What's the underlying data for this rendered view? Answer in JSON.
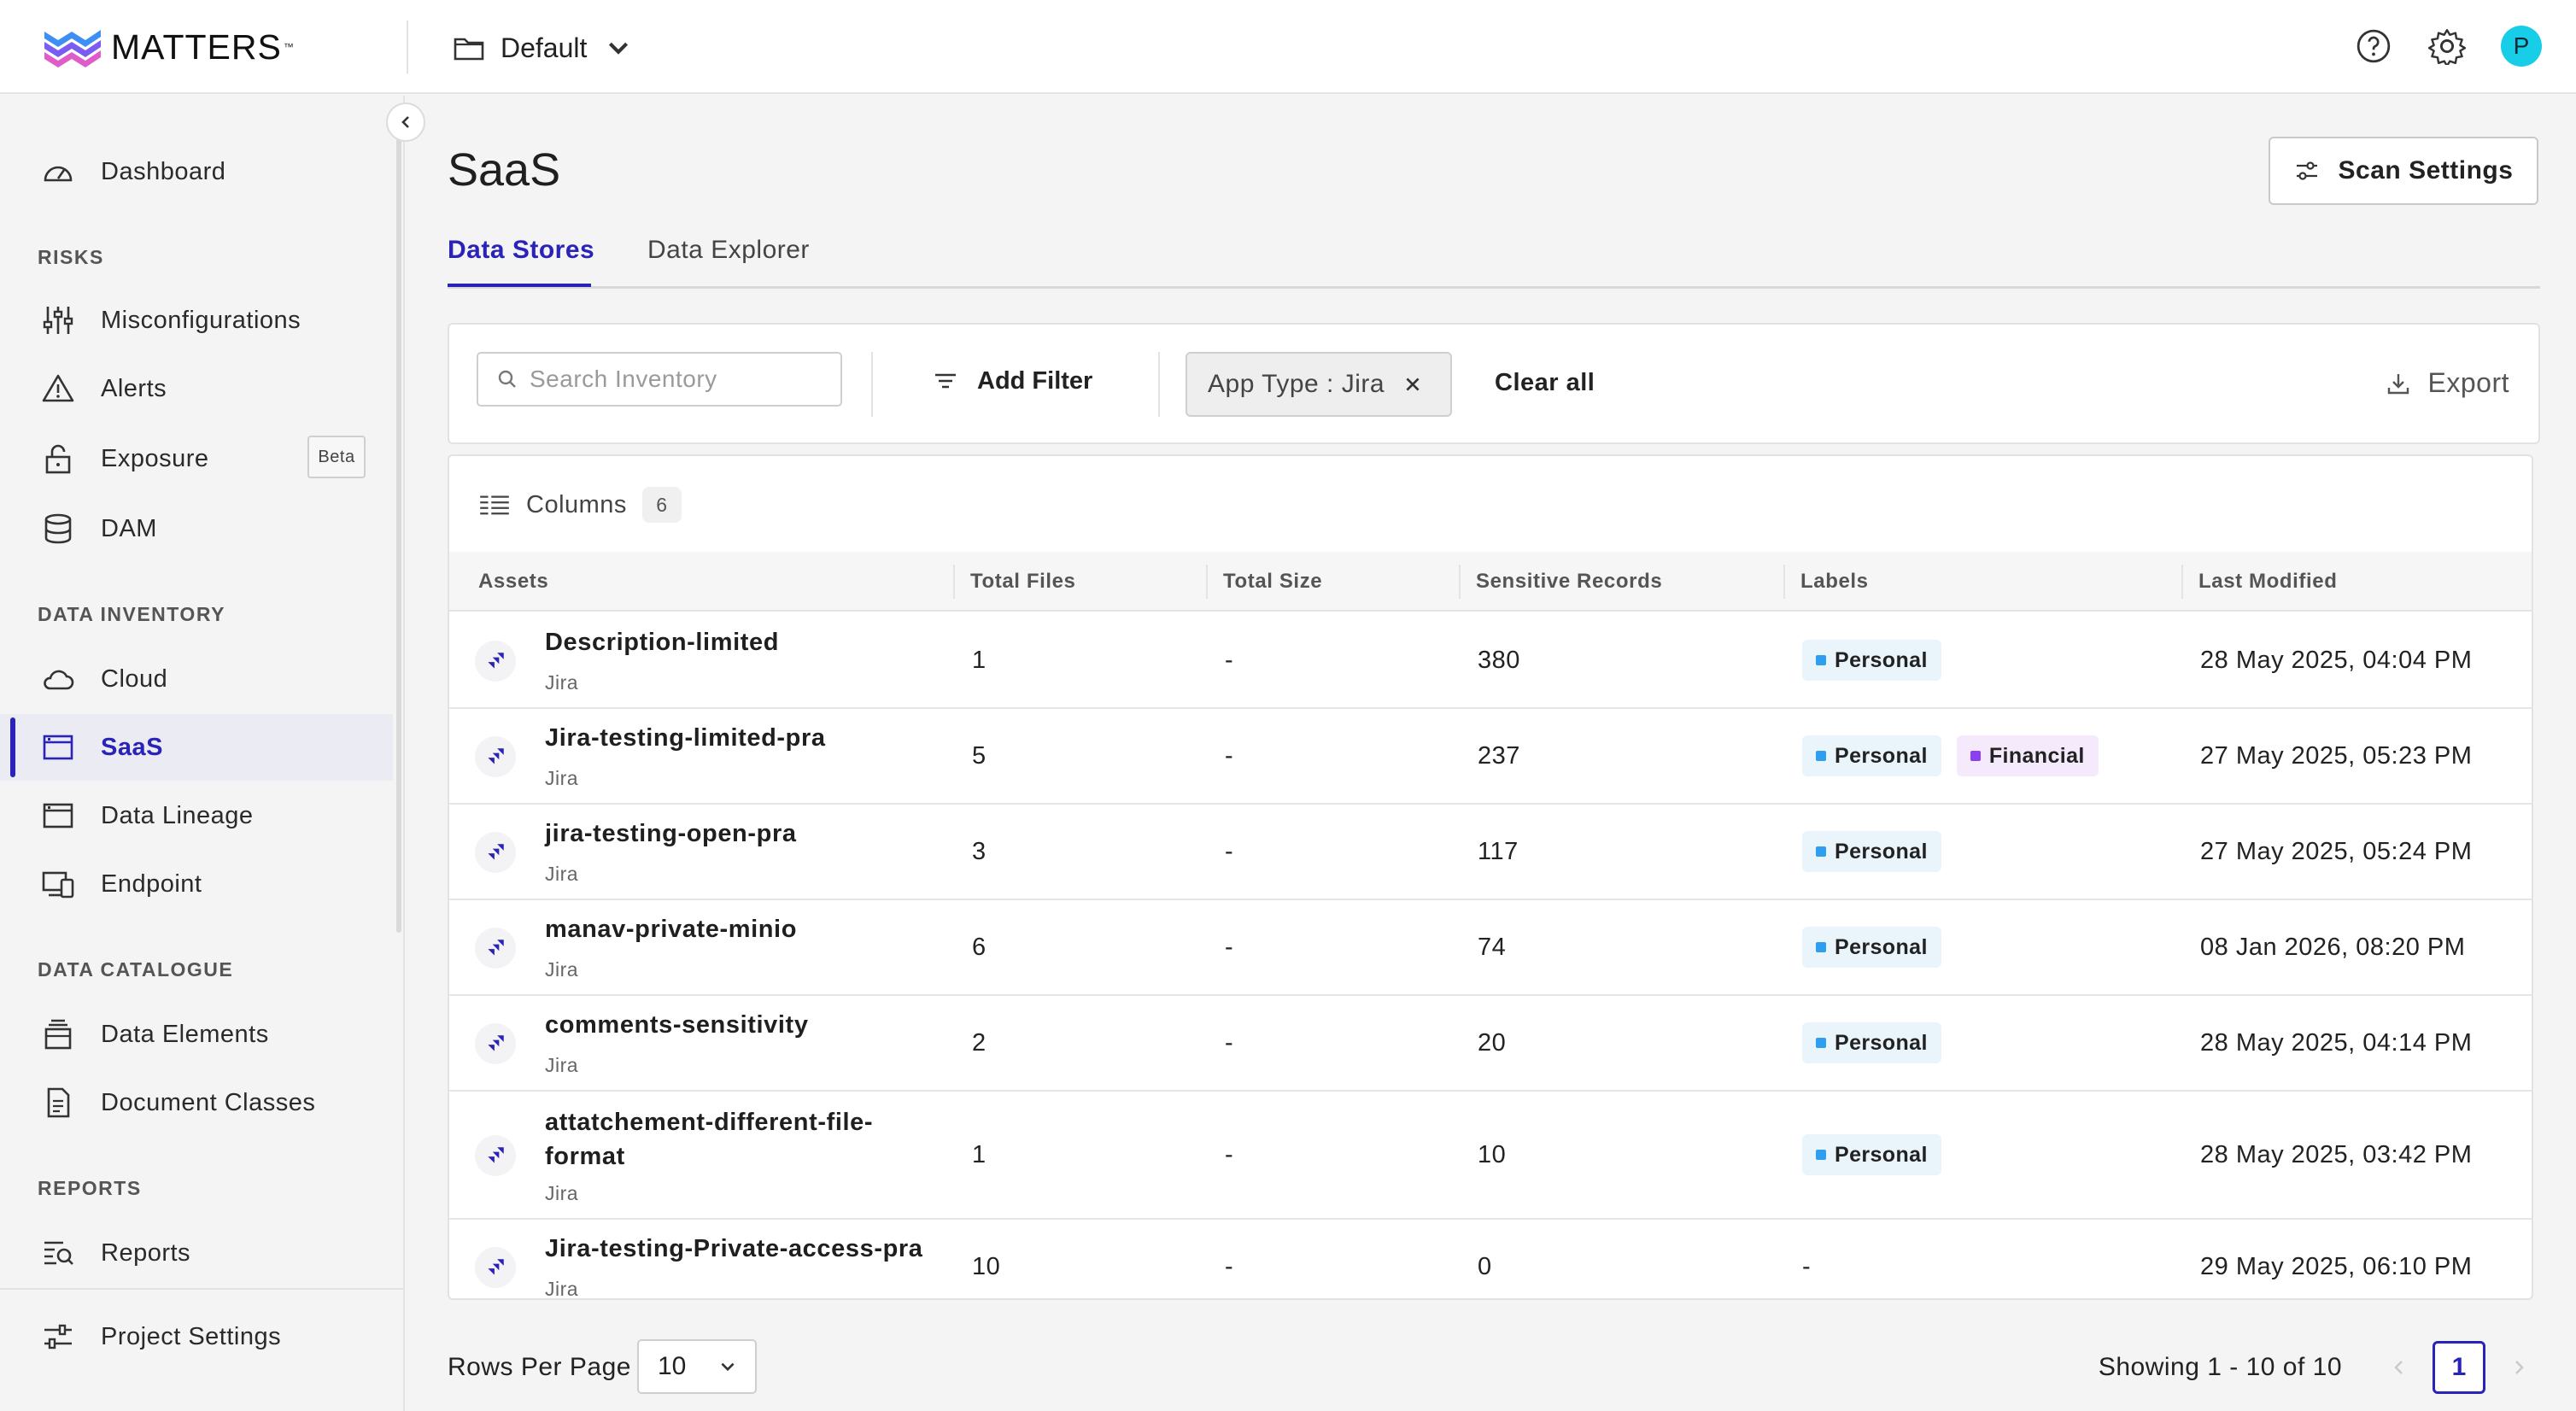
{
  "app": {
    "brand": "MATTERS",
    "brand_tm": "™",
    "project": "Default",
    "avatar_initial": "P",
    "accent_color": "#2a23b8"
  },
  "sidebar": {
    "items_top": [
      {
        "label": "Dashboard",
        "icon": "dashboard-icon"
      }
    ],
    "sections": [
      {
        "title": "RISKS",
        "items": [
          {
            "label": "Misconfigurations",
            "icon": "sliders-icon"
          },
          {
            "label": "Alerts",
            "icon": "alert-icon"
          },
          {
            "label": "Exposure",
            "icon": "lock-open-icon",
            "badge": "Beta"
          },
          {
            "label": "DAM",
            "icon": "database-icon"
          }
        ]
      },
      {
        "title": "DATA INVENTORY",
        "items": [
          {
            "label": "Cloud",
            "icon": "cloud-icon"
          },
          {
            "label": "SaaS",
            "icon": "window-icon",
            "active": true
          },
          {
            "label": "Data Lineage",
            "icon": "window-icon"
          },
          {
            "label": "Endpoint",
            "icon": "devices-icon"
          }
        ]
      },
      {
        "title": "DATA CATALOGUE",
        "items": [
          {
            "label": "Data Elements",
            "icon": "stack-icon"
          },
          {
            "label": "Document Classes",
            "icon": "document-icon"
          }
        ]
      },
      {
        "title": "REPORTS",
        "items": [
          {
            "label": "Reports",
            "icon": "report-search-icon"
          }
        ]
      }
    ],
    "footer": {
      "label": "Project Settings",
      "icon": "settings-sliders-icon"
    }
  },
  "main": {
    "title": "SaaS",
    "scan_settings": "Scan Settings",
    "tabs": [
      {
        "label": "Data Stores",
        "active": true
      },
      {
        "label": "Data Explorer"
      }
    ],
    "filter": {
      "search_placeholder": "Search Inventory",
      "add_filter": "Add Filter",
      "chip": "App Type : Jira",
      "clear_all": "Clear all",
      "export": "Export"
    },
    "columns_label": "Columns",
    "columns_count": "6",
    "table": {
      "headers": [
        "Assets",
        "Total Files",
        "Total Size",
        "Sensitive Records",
        "Labels",
        "Last Modified"
      ],
      "rows": [
        {
          "name": "Description-limited",
          "source": "Jira",
          "files": "1",
          "size": "-",
          "records": "380",
          "labels": [
            "Personal"
          ],
          "modified": "28 May 2025, 04:04 PM"
        },
        {
          "name": "Jira-testing-limited-pra",
          "source": "Jira",
          "files": "5",
          "size": "-",
          "records": "237",
          "labels": [
            "Personal",
            "Financial"
          ],
          "modified": "27 May 2025, 05:23 PM"
        },
        {
          "name": "jira-testing-open-pra",
          "source": "Jira",
          "files": "3",
          "size": "-",
          "records": "117",
          "labels": [
            "Personal"
          ],
          "modified": "27 May 2025, 05:24 PM"
        },
        {
          "name": "manav-private-minio",
          "source": "Jira",
          "files": "6",
          "size": "-",
          "records": "74",
          "labels": [
            "Personal"
          ],
          "modified": "08 Jan 2026, 08:20 PM"
        },
        {
          "name": "comments-sensitivity",
          "source": "Jira",
          "files": "2",
          "size": "-",
          "records": "20",
          "labels": [
            "Personal"
          ],
          "modified": "28 May 2025, 04:14 PM"
        },
        {
          "name": "attatchement-different-file-format",
          "source": "Jira",
          "files": "1",
          "size": "-",
          "records": "10",
          "labels": [
            "Personal"
          ],
          "modified": "28 May 2025, 03:42 PM"
        },
        {
          "name": "Jira-testing-Private-access-pra",
          "source": "Jira",
          "files": "10",
          "size": "-",
          "records": "0",
          "labels": [],
          "labels_empty": "-",
          "modified": "29 May 2025, 06:10 PM"
        }
      ]
    },
    "pagination": {
      "rows_per_page_label": "Rows Per Page",
      "rows_per_page": "10",
      "showing": "Showing 1 - 10 of 10",
      "current_page": "1"
    },
    "label_colors": {
      "Personal": "#2f9ef0",
      "Financial": "#8a3ff0"
    }
  }
}
